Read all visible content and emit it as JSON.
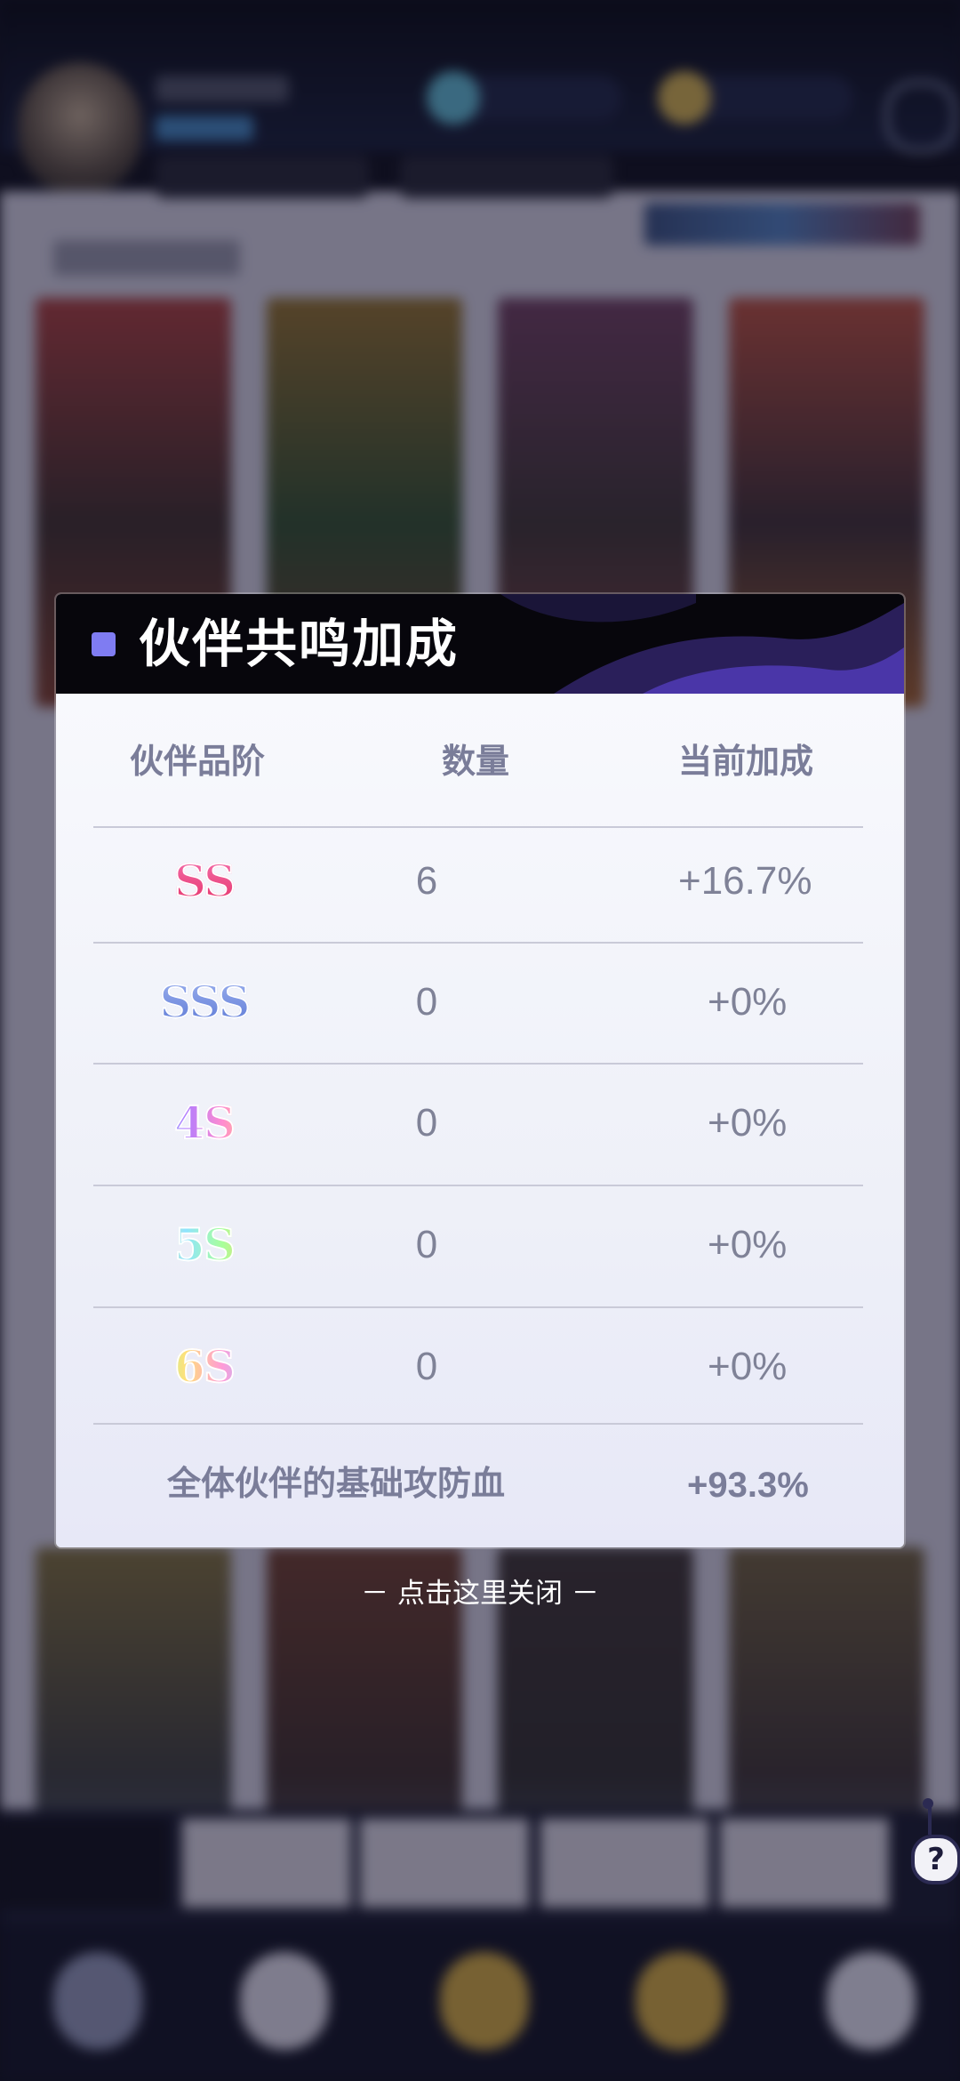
{
  "modal": {
    "title": "伙伴共鸣加成",
    "columns": [
      "伙伴品阶",
      "数量",
      "当前加成"
    ],
    "rows": [
      {
        "grade": "SS",
        "count": "6",
        "bonus": "+16.7%"
      },
      {
        "grade": "SSS",
        "count": "0",
        "bonus": "+0%"
      },
      {
        "grade": "4S",
        "count": "0",
        "bonus": "+0%"
      },
      {
        "grade": "5S",
        "count": "0",
        "bonus": "+0%"
      },
      {
        "grade": "6S",
        "count": "0",
        "bonus": "+0%"
      }
    ],
    "total_label": "全体伙伴的基础攻防血",
    "total_value": "+93.3%"
  },
  "close_hint": "－ 点击这里关闭 －",
  "help_icon": "?",
  "colors": {
    "accent": "#7f7cf2",
    "header_bg": "#07060c",
    "text_muted": "#7a7d99"
  }
}
